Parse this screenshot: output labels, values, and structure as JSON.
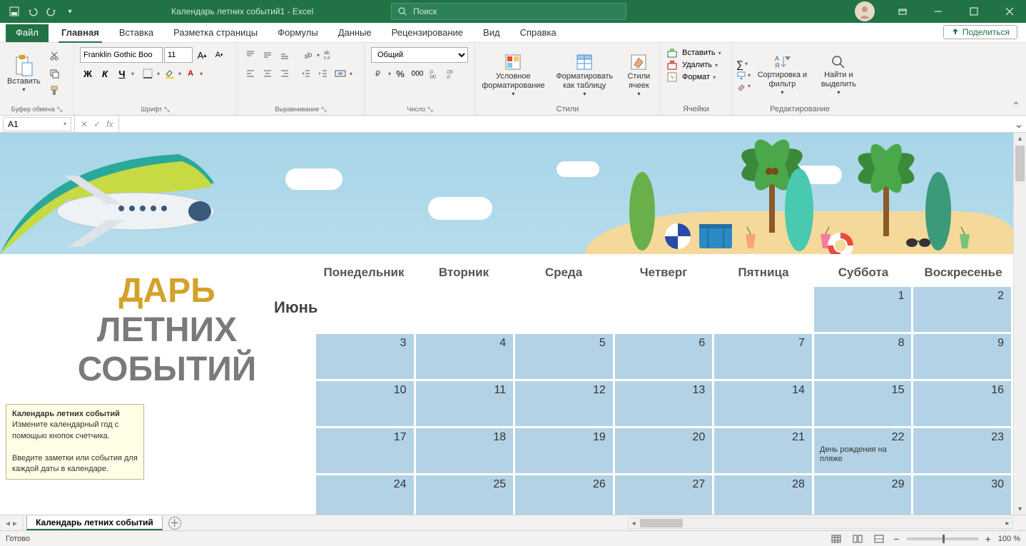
{
  "title_bar": {
    "document_title": "Календарь летних событий1  -  Excel",
    "search_placeholder": "Поиск"
  },
  "tabs": {
    "file": "Файл",
    "home": "Главная",
    "insert": "Вставка",
    "page_layout": "Разметка страницы",
    "formulas": "Формулы",
    "data": "Данные",
    "review": "Рецензирование",
    "view": "Вид",
    "help": "Справка",
    "share": "Поделиться"
  },
  "ribbon": {
    "clipboard": {
      "paste": "Вставить",
      "label": "Буфер обмена"
    },
    "font": {
      "name": "Franklin Gothic Boo",
      "size": "11",
      "bold": "Ж",
      "italic": "К",
      "underline": "Ч",
      "label": "Шрифт"
    },
    "alignment": {
      "label": "Выравнивание"
    },
    "number": {
      "format": "Общий",
      "label": "Число"
    },
    "styles": {
      "conditional": "Условное форматирование",
      "as_table": "Форматировать как таблицу",
      "cell_styles": "Стили ячеек",
      "label": "Стили"
    },
    "cells": {
      "insert": "Вставить",
      "delete": "Удалить",
      "format": "Формат",
      "label": "Ячейки"
    },
    "editing": {
      "sort_filter": "Сортировка и фильтр",
      "find_select": "Найти и выделить",
      "label": "Редактирование"
    }
  },
  "formula_bar": {
    "cell_ref": "A1",
    "formula": ""
  },
  "tooltip": {
    "title": "Календарь летних событий",
    "line1": "Измените календарный год с помощью кнопок счетчика.",
    "line2": "Введите заметки или события для каждой даты в календаре."
  },
  "calendar": {
    "title_part1": "ДАРЬ",
    "title_line2": "ЛЕТНИХ",
    "title_line3": "СОБЫТИЙ",
    "month": "Июнь",
    "days": [
      "Понедельник",
      "Вторник",
      "Среда",
      "Четверг",
      "Пятница",
      "Суббота",
      "Воскресенье"
    ],
    "weeks": [
      [
        null,
        null,
        null,
        null,
        null,
        {
          "n": "1"
        },
        {
          "n": "2"
        }
      ],
      [
        {
          "n": "3"
        },
        {
          "n": "4"
        },
        {
          "n": "5"
        },
        {
          "n": "6"
        },
        {
          "n": "7"
        },
        {
          "n": "8"
        },
        {
          "n": "9"
        }
      ],
      [
        {
          "n": "10"
        },
        {
          "n": "11"
        },
        {
          "n": "12"
        },
        {
          "n": "13"
        },
        {
          "n": "14"
        },
        {
          "n": "15"
        },
        {
          "n": "16"
        }
      ],
      [
        {
          "n": "17"
        },
        {
          "n": "18"
        },
        {
          "n": "19"
        },
        {
          "n": "20"
        },
        {
          "n": "21"
        },
        {
          "n": "22",
          "event": "День рождения на пляже"
        },
        {
          "n": "23"
        }
      ],
      [
        {
          "n": "24"
        },
        {
          "n": "25"
        },
        {
          "n": "26"
        },
        {
          "n": "27"
        },
        {
          "n": "28"
        },
        {
          "n": "29"
        },
        {
          "n": "30"
        }
      ]
    ]
  },
  "sheet_tabs": {
    "active": "Календарь летних событий"
  },
  "status_bar": {
    "ready": "Готово",
    "zoom": "100 %"
  }
}
